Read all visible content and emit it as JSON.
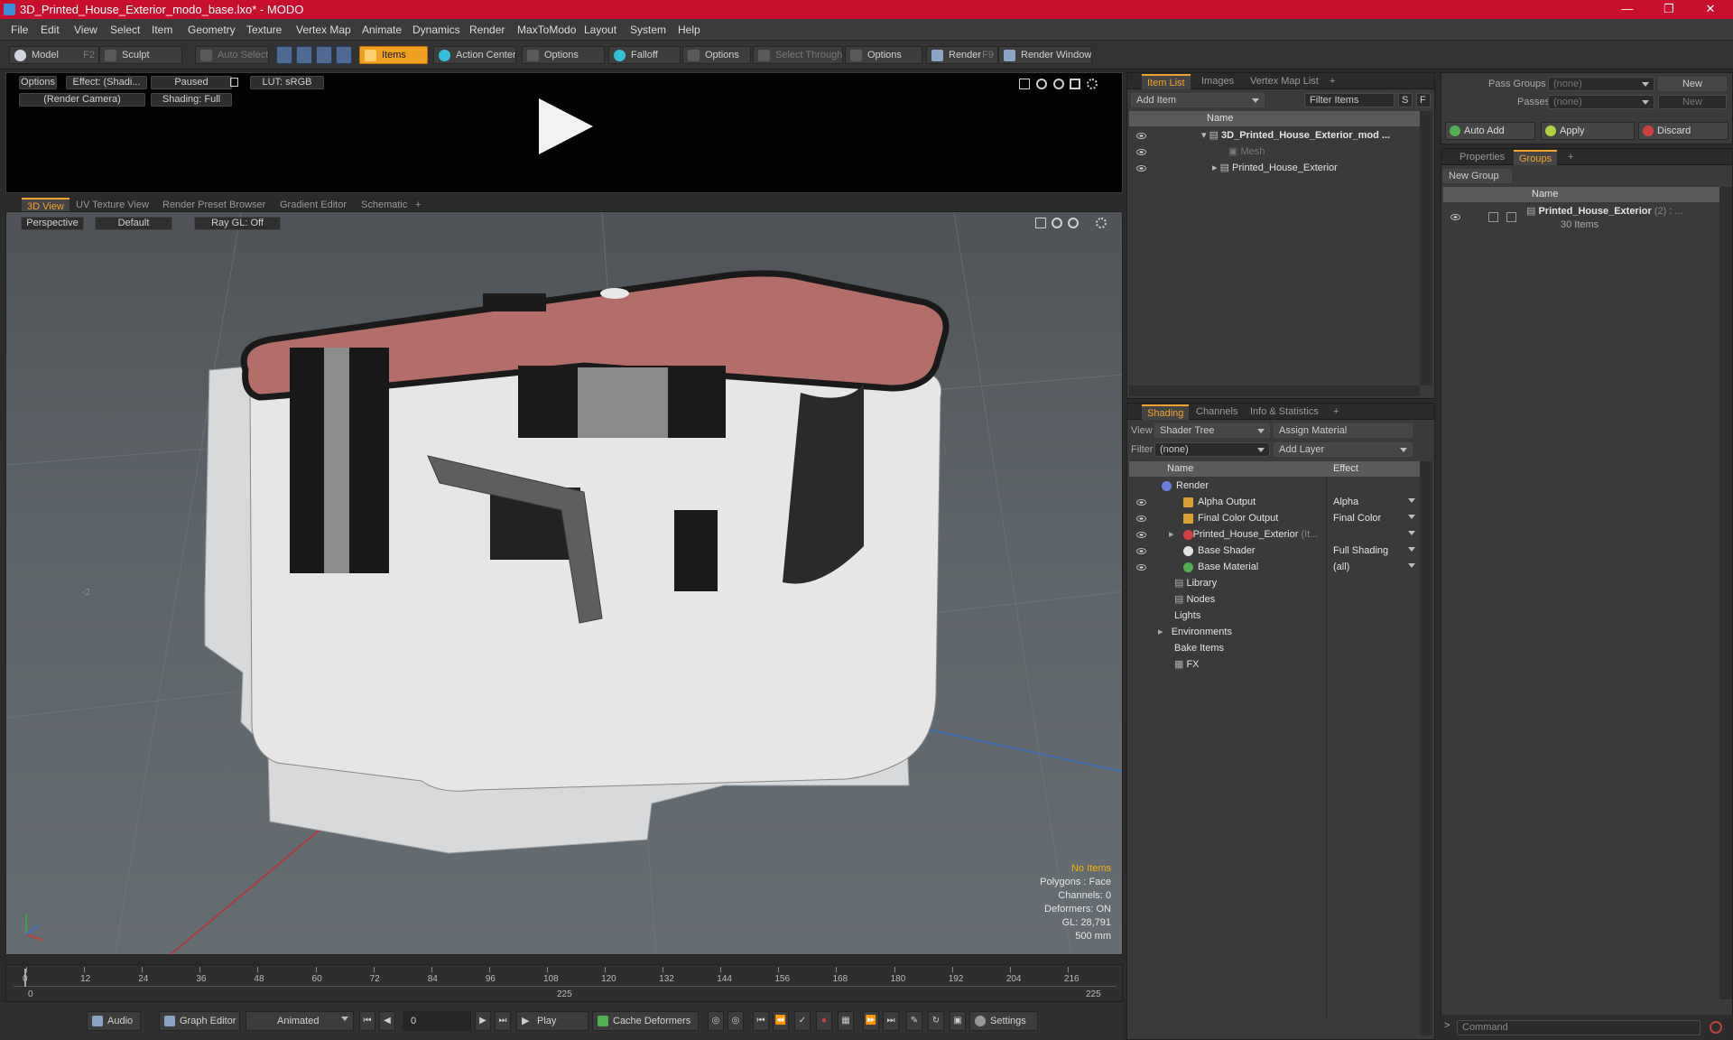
{
  "window": {
    "title": "3D_Printed_House_Exterior_modo_base.lxo* - MODO",
    "min": "—",
    "max": "❐",
    "close": "✕"
  },
  "menu": [
    "File",
    "Edit",
    "View",
    "Select",
    "Item",
    "Geometry",
    "Texture",
    "Vertex Map",
    "Animate",
    "Dynamics",
    "Render",
    "MaxToModo",
    "Layout",
    "System",
    "Help"
  ],
  "toolbar": {
    "model": "Model",
    "model_key": "F2",
    "sculpt": "Sculpt",
    "auto_select": "Auto Select",
    "items": "Items",
    "action_center": "Action Center",
    "options1": "Options",
    "falloff": "Falloff",
    "options2": "Options",
    "select_through": "Select Through",
    "options3": "Options",
    "render": "Render",
    "render_key": "F9",
    "render_window": "Render Window"
  },
  "preview": {
    "options": "Options",
    "effect": "Effect: (Shadi...",
    "paused": "Paused",
    "lut": "LUT: sRGB",
    "camera": "(Render Camera)",
    "shading": "Shading: Full"
  },
  "viewport_tabs": [
    "3D View",
    "UV Texture View",
    "Render Preset Browser",
    "Gradient Editor",
    "Schematic",
    "+"
  ],
  "viewport": {
    "perspective": "Perspective",
    "default": "Default",
    "raygl": "Ray GL: Off",
    "grid_label": "-2",
    "info": {
      "no_items": "No Items",
      "polygons": "Polygons : Face",
      "channels": "Channels: 0",
      "deformers": "Deformers: ON",
      "gl": "GL: 28,791",
      "scale": "500 mm"
    }
  },
  "timeline": {
    "ticks": [
      "0",
      "12",
      "24",
      "36",
      "48",
      "60",
      "72",
      "84",
      "96",
      "108",
      "120",
      "132",
      "144",
      "156",
      "168",
      "180",
      "192",
      "204",
      "216"
    ],
    "start": "0",
    "mid": "225",
    "end": "225",
    "current": 0,
    "total": 225
  },
  "bottombar": {
    "audio": "Audio",
    "graph_editor": "Graph Editor",
    "animated": "Animated",
    "frame": "0",
    "play": "Play",
    "cache": "Cache Deformers",
    "settings": "Settings"
  },
  "itemlist": {
    "tabs": [
      "Item List",
      "Images",
      "Vertex Map List",
      "+"
    ],
    "add_item": "Add Item",
    "filter": "Filter Items",
    "s": "S",
    "f": "F",
    "col_name": "Name",
    "rows": [
      {
        "label": "3D_Printed_House_Exterior_mod ...",
        "bold": true
      },
      {
        "label": "Mesh",
        "dim": true
      },
      {
        "label": "Printed_House_Exterior"
      }
    ]
  },
  "shading": {
    "tabs": [
      "Shading",
      "Channels",
      "Info & Statistics",
      "+"
    ],
    "view_label": "View",
    "view": "Shader Tree",
    "assign": "Assign Material",
    "filter_label": "Filter",
    "filter": "(none)",
    "add_layer": "Add Layer",
    "col_name": "Name",
    "col_effect": "Effect",
    "rows": [
      {
        "name": "Render",
        "effect": "",
        "color": "#6a7fe0"
      },
      {
        "name": "Alpha Output",
        "effect": "Alpha",
        "color": "#d8a030"
      },
      {
        "name": "Final Color Output",
        "effect": "Final Color",
        "color": "#d8a030"
      },
      {
        "name": "Printed_House_Exterior",
        "suffix": "(It...",
        "effect": "",
        "color": "#d04040"
      },
      {
        "name": "Base Shader",
        "effect": "Full Shading",
        "color": "#e0e0e0"
      },
      {
        "name": "Base Material",
        "effect": "(all)",
        "color": "#50b050"
      },
      {
        "name": "Library",
        "effect": ""
      },
      {
        "name": "Nodes",
        "effect": ""
      },
      {
        "name": "Lights",
        "effect": ""
      },
      {
        "name": "Environments",
        "effect": ""
      },
      {
        "name": "Bake Items",
        "effect": ""
      },
      {
        "name": "FX",
        "effect": ""
      }
    ]
  },
  "passes": {
    "pass_groups_label": "Pass Groups",
    "pass_groups": "(none)",
    "new1": "New",
    "passes_label": "Passes",
    "passes": "(none)",
    "new2": "New",
    "auto_add": "Auto Add",
    "apply": "Apply",
    "discard": "Discard"
  },
  "groups": {
    "tabs": [
      "Properties",
      "Groups",
      "+"
    ],
    "new_group": "New Group",
    "col_name": "Name",
    "group_name": "Printed_House_Exterior",
    "group_count": "(2) : ...",
    "items": "30 Items"
  },
  "command": {
    "placeholder": "Command"
  }
}
